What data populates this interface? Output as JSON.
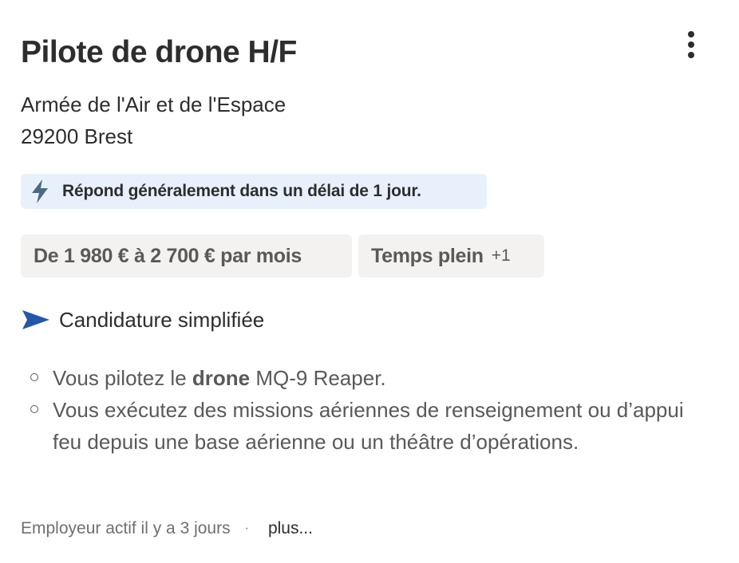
{
  "job": {
    "title": "Pilote de drone H/F",
    "company": "Armée de l'Air et de l'Espace",
    "location": "29200 Brest",
    "response_badge": {
      "text": "Répond généralement dans un délai de 1 jour.",
      "icon": "bolt-icon"
    },
    "chips": {
      "salary": "De 1 980 € à 2 700 € par mois",
      "job_type": "Temps plein",
      "job_type_extra": "+1"
    },
    "easy_apply": {
      "label": "Candidature simplifiée",
      "icon": "send-arrow-icon"
    },
    "snippet": {
      "item1_before": "Vous pilotez le ",
      "item1_bold": "drone",
      "item1_after": " MQ-9 Reaper.",
      "item2": "Vous exécutez des missions aériennes de renseignement ou d’appui feu depuis une base aérienne ou un théâtre d’opérations."
    },
    "footer": {
      "activity": "Employeur actif il y a 3 jours",
      "separator": "·",
      "more_link": "plus..."
    }
  },
  "colors": {
    "text_primary": "#2d2d2d",
    "text_secondary": "#595959",
    "badge_background": "#e8f1fb",
    "chip_background": "#f3f2f1",
    "accent_blue": "#2557a7"
  }
}
